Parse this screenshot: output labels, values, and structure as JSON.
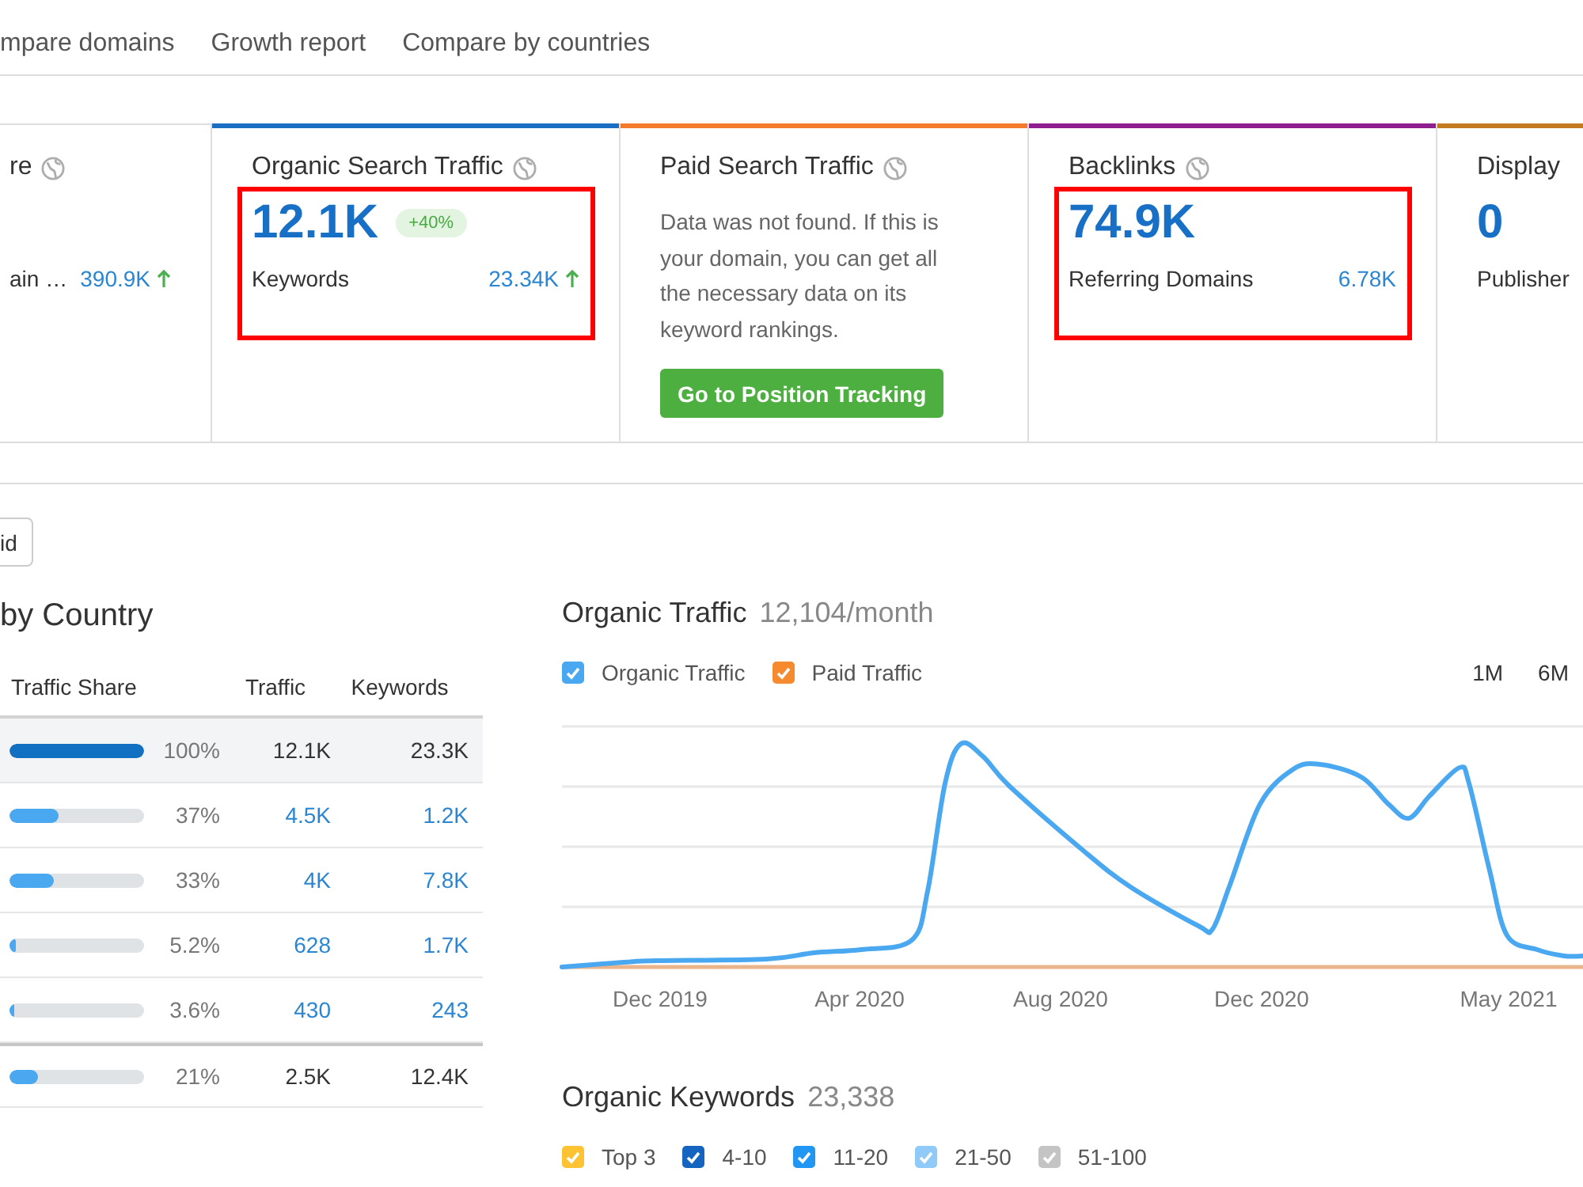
{
  "nav_tabs": [
    {
      "label": "mpare domains"
    },
    {
      "label": "Growth report"
    },
    {
      "label": "Compare by countries"
    }
  ],
  "metric_cards": [
    {
      "kind": "metric",
      "title": "re",
      "globe": true,
      "rows": [
        {
          "label": "ain …",
          "value": "390.9K",
          "trending_up": true
        }
      ]
    },
    {
      "kind": "metric",
      "title": "Organic Search Traffic",
      "globe": true,
      "color": "#1b6fc2",
      "value": "12.1K",
      "badge": "+40%",
      "highlight": true,
      "rows": [
        {
          "label": "Keywords",
          "value": "23.34K",
          "trending_up": true
        }
      ]
    },
    {
      "kind": "message",
      "title": "Paid Search Traffic",
      "globe": true,
      "color": "#f47b2b",
      "message": "Data was not found. If this is your domain, you can get all the necessary data on its keyword rankings.",
      "button": "Go to Position Tracking"
    },
    {
      "kind": "metric",
      "title": "Backlinks",
      "globe": true,
      "color": "#8f1f8f",
      "value": "74.9K",
      "highlight": true,
      "rows": [
        {
          "label": "Referring Domains",
          "value": "6.78K"
        }
      ]
    },
    {
      "kind": "metric",
      "title": "Display",
      "color": "#c47a20",
      "value": "0",
      "rows": [
        {
          "label": "Publisher"
        }
      ]
    }
  ],
  "button": {
    "label": "id"
  },
  "traffic_by_country": {
    "title": "by Country",
    "columns": [
      "Traffic Share",
      "Traffic",
      "Keywords"
    ],
    "rows": [
      {
        "kind": "country",
        "selected": true,
        "level": 1,
        "share": "100%",
        "traffic": "12.1K",
        "keywords": "23.3K"
      },
      {
        "kind": "country",
        "selected": false,
        "level": 0.37,
        "share": "37%",
        "traffic": "4.5K",
        "keywords": "1.2K"
      },
      {
        "kind": "country",
        "selected": false,
        "level": 0.33,
        "share": "33%",
        "traffic": "4K",
        "keywords": "7.8K"
      },
      {
        "kind": "country",
        "selected": false,
        "level": 0.052,
        "share": "5.2%",
        "traffic": "628",
        "keywords": "1.7K"
      },
      {
        "kind": "country",
        "selected": false,
        "level": 0.036,
        "share": "3.6%",
        "traffic": "430",
        "keywords": "243"
      },
      {
        "kind": "other",
        "selected": false,
        "level": 0.21,
        "share": "21%",
        "traffic": "2.5K",
        "keywords": "12.4K"
      }
    ]
  },
  "organic_traffic": {
    "title": "Organic Traffic",
    "summary": "12,104/month",
    "legend": [
      {
        "label": "Organic Traffic",
        "color": "#4aa8f0",
        "checked": true
      },
      {
        "label": "Paid Traffic",
        "color": "#f58a2e",
        "checked": true
      }
    ],
    "periods": [
      {
        "label": "1M",
        "selected": false
      },
      {
        "label": "6M",
        "selected": false
      }
    ],
    "x_labels": [
      "Dec 2019",
      "Apr 2020",
      "Aug 2020",
      "Dec 2020",
      "May 2021"
    ]
  },
  "organic_keywords": {
    "title": "Organic Keywords",
    "summary": "23,338",
    "legend": [
      {
        "label": "Top 3",
        "color": "#ffc233",
        "checked": true
      },
      {
        "label": "4-10",
        "color": "#1565c0",
        "checked": true
      },
      {
        "label": "11-20",
        "color": "#2196f3",
        "checked": true
      },
      {
        "label": "21-50",
        "color": "#90caf9",
        "checked": true
      },
      {
        "label": "51-100",
        "color": "#c4c4c4",
        "checked": true
      }
    ]
  }
}
